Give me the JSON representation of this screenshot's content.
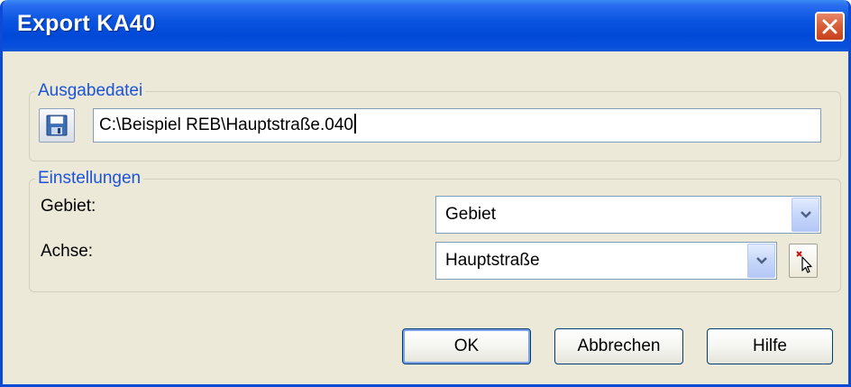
{
  "window": {
    "title": "Export KA40"
  },
  "output_group": {
    "label": "Ausgabedatei",
    "file_path": "C:\\Beispiel REB\\Hauptstraße.040"
  },
  "settings_group": {
    "label": "Einstellungen",
    "area_label": "Gebiet:",
    "area_value": "Gebiet",
    "axis_label": "Achse:",
    "axis_value": "Hauptstraße"
  },
  "buttons": {
    "ok": "OK",
    "cancel": "Abbrechen",
    "help": "Hilfe"
  },
  "icons": {
    "close": "close-icon",
    "save": "floppy-disk-icon",
    "dropdown": "chevron-down-icon",
    "pick": "cursor-pick-icon"
  },
  "colors": {
    "title_bar": "#0a54e0",
    "group_label": "#1d53d8",
    "dialog_bg": "#ece9d8",
    "close_button": "#d95f3a"
  }
}
